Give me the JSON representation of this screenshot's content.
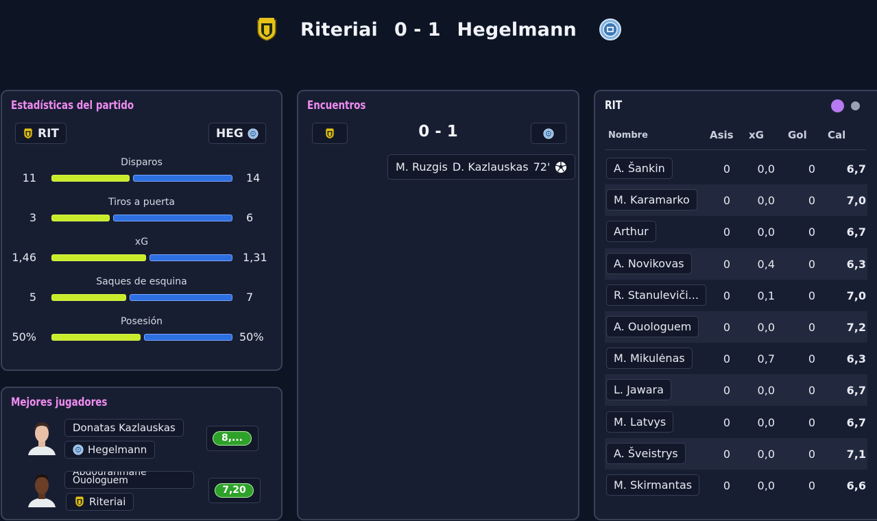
{
  "header": {
    "home_team": "Riteriai",
    "score": "0 - 1",
    "away_team": "Hegelmann"
  },
  "colors": {
    "home_bar": "#c8ec2a",
    "away_bar": "#2c6fe0",
    "title_accent": "#ef8cf0",
    "rating_green": "#2ea12a"
  },
  "stats": {
    "title": "Estadísticas del partido",
    "home_abbr": "RIT",
    "away_abbr": "HEG",
    "rows": [
      {
        "label": "Disparos",
        "home": "11",
        "away": "14",
        "home_share": 0.44
      },
      {
        "label": "Tiros a puerta",
        "home": "3",
        "away": "6",
        "home_share": 0.33
      },
      {
        "label": "xG",
        "home": "1,46",
        "away": "1,31",
        "home_share": 0.53
      },
      {
        "label": "Saques de esquina",
        "home": "5",
        "away": "7",
        "home_share": 0.42
      },
      {
        "label": "Posesión",
        "home": "50%",
        "away": "50%",
        "home_share": 0.5
      }
    ]
  },
  "encounters": {
    "title": "Encuentros",
    "score": "0 - 1",
    "event": {
      "assist": "M. Ruzgis",
      "scorer": "D. Kazlauskas",
      "minute": "72'",
      "icon": "soccer-ball-icon"
    }
  },
  "best_players": {
    "title": "Mejores jugadores",
    "players": [
      {
        "name": "Donatas Kazlauskas",
        "team": "Hegelmann",
        "rating": "8,..."
      },
      {
        "name": "Abdourahmane Ouologuem",
        "team": "Riteriai",
        "rating": "7,20"
      }
    ]
  },
  "players_table": {
    "team": "RIT",
    "headers": {
      "name": "Nombre",
      "assists": "Asis",
      "xg": "xG",
      "goals": "Gol",
      "rating": "Cal"
    },
    "rows": [
      {
        "name": "A. Šankin",
        "asis": "0",
        "xg": "0,0",
        "gol": "0",
        "cal": "6,7"
      },
      {
        "name": "M. Karamarko",
        "asis": "0",
        "xg": "0,0",
        "gol": "0",
        "cal": "7,0"
      },
      {
        "name": "Arthur",
        "asis": "0",
        "xg": "0,0",
        "gol": "0",
        "cal": "6,7"
      },
      {
        "name": "A. Novikovas",
        "asis": "0",
        "xg": "0,4",
        "gol": "0",
        "cal": "6,3"
      },
      {
        "name": "R. Stanuleviči...",
        "asis": "0",
        "xg": "0,1",
        "gol": "0",
        "cal": "7,0"
      },
      {
        "name": "A. Ouologuem",
        "asis": "0",
        "xg": "0,0",
        "gol": "0",
        "cal": "7,2"
      },
      {
        "name": "M. Mikulėnas",
        "asis": "0",
        "xg": "0,7",
        "gol": "0",
        "cal": "6,3"
      },
      {
        "name": "L. Jawara",
        "asis": "0",
        "xg": "0,0",
        "gol": "0",
        "cal": "6,7"
      },
      {
        "name": "M. Latvys",
        "asis": "0",
        "xg": "0,0",
        "gol": "0",
        "cal": "6,7"
      },
      {
        "name": "A. Šveistrys",
        "asis": "0",
        "xg": "0,0",
        "gol": "0",
        "cal": "7,1"
      },
      {
        "name": "M. Skirmantas",
        "asis": "0",
        "xg": "0,0",
        "gol": "0",
        "cal": "6,6"
      }
    ]
  }
}
